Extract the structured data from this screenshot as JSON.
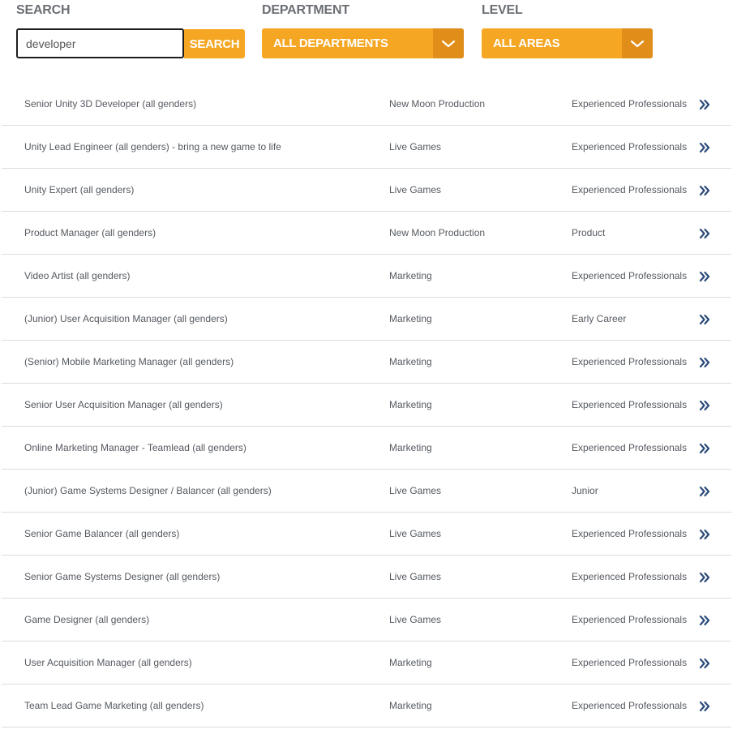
{
  "filters": {
    "search": {
      "label": "SEARCH",
      "value": "developer",
      "button_label": "SEARCH"
    },
    "department": {
      "label": "DEPARTMENT",
      "selected": "ALL DEPARTMENTS"
    },
    "level": {
      "label": "LEVEL",
      "selected": "ALL AREAS"
    }
  },
  "colors": {
    "accent": "#f5a623",
    "accent_dark": "#e08d1a",
    "arrow": "#2b4a7a"
  },
  "jobs": [
    {
      "title": "Senior Unity 3D Developer (all genders)",
      "department": "New Moon Production",
      "level": "Experienced Professionals"
    },
    {
      "title": "Unity Lead Engineer (all genders) - bring a new game to life",
      "department": "Live Games",
      "level": "Experienced Professionals"
    },
    {
      "title": "Unity Expert (all genders)",
      "department": "Live Games",
      "level": "Experienced Professionals"
    },
    {
      "title": "Product Manager (all genders)",
      "department": "New Moon Production",
      "level": "Product"
    },
    {
      "title": "Video Artist (all genders)",
      "department": "Marketing",
      "level": "Experienced Professionals"
    },
    {
      "title": "(Junior) User Acquisition Manager (all genders)",
      "department": "Marketing",
      "level": "Early Career"
    },
    {
      "title": "(Senior) Mobile Marketing Manager (all genders)",
      "department": "Marketing",
      "level": "Experienced Professionals"
    },
    {
      "title": "Senior User Acquisition Manager (all genders)",
      "department": "Marketing",
      "level": "Experienced Professionals"
    },
    {
      "title": "Online Marketing Manager - Teamlead (all genders)",
      "department": "Marketing",
      "level": "Experienced Professionals"
    },
    {
      "title": "(Junior) Game Systems Designer / Balancer (all genders)",
      "department": "Live Games",
      "level": "Junior"
    },
    {
      "title": "Senior Game Balancer (all genders)",
      "department": "Live Games",
      "level": "Experienced Professionals"
    },
    {
      "title": "Senior Game Systems Designer (all genders)",
      "department": "Live Games",
      "level": "Experienced Professionals"
    },
    {
      "title": "Game Designer (all genders)",
      "department": "Live Games",
      "level": "Experienced Professionals"
    },
    {
      "title": "User Acquisition Manager (all genders)",
      "department": "Marketing",
      "level": "Experienced Professionals"
    },
    {
      "title": "Team Lead Game Marketing (all genders)",
      "department": "Marketing",
      "level": "Experienced Professionals"
    }
  ]
}
